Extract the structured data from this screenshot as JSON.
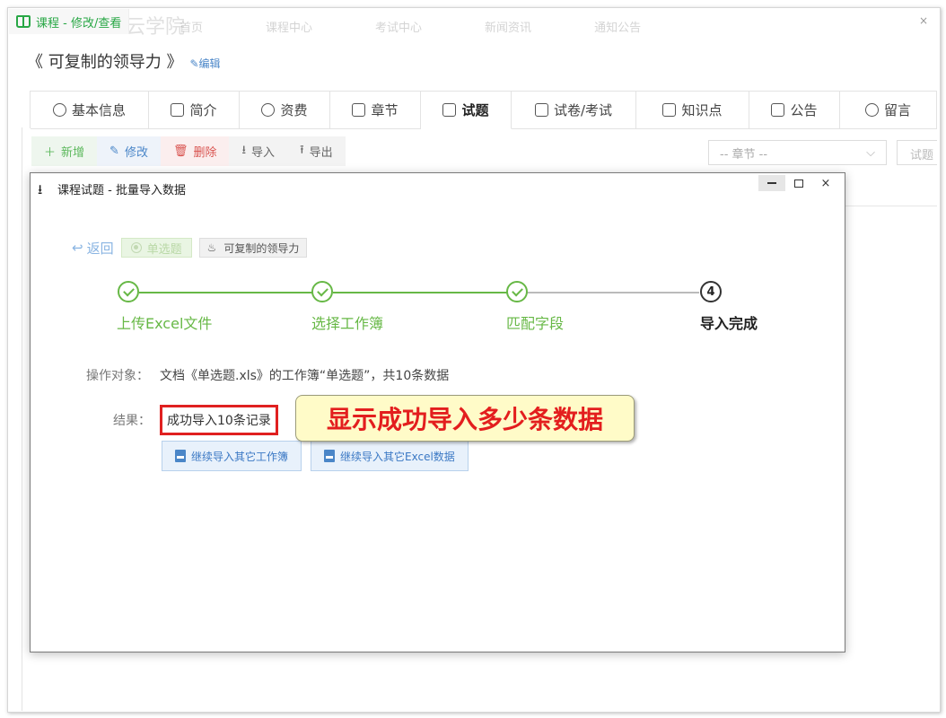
{
  "window": {
    "tab_title": "课程 - 修改/查看",
    "close_symbol": "×",
    "bg_nav": [
      "首页",
      "课程中心",
      "考试中心",
      "新闻资讯",
      "通知公告"
    ]
  },
  "course": {
    "title": "《 可复制的领导力 》",
    "edit_label": "编辑"
  },
  "tabs": [
    {
      "label": "基本信息",
      "icon": "gear-icon"
    },
    {
      "label": "简介",
      "icon": "doc-edit-icon"
    },
    {
      "label": "资费",
      "icon": "money-bag-icon"
    },
    {
      "label": "章节",
      "icon": "chapter-icon"
    },
    {
      "label": "试题",
      "icon": "list-icon",
      "active": true
    },
    {
      "label": "试卷/考试",
      "icon": "paper-icon"
    },
    {
      "label": "知识点",
      "icon": "note-icon"
    },
    {
      "label": "公告",
      "icon": "notice-icon"
    },
    {
      "label": "留言",
      "icon": "message-icon"
    }
  ],
  "toolbar": {
    "add": "新增",
    "modify": "修改",
    "delete": "删除",
    "import": "导入",
    "export": "导出"
  },
  "filters": {
    "chapter_placeholder": "-- 章节 --",
    "search_placeholder": "试题"
  },
  "dialog": {
    "title": "课程试题 - 批量导入数据",
    "back": "返回",
    "question_type": "单选题",
    "course_tag": "可复制的领导力",
    "steps": [
      {
        "label": "上传Excel文件",
        "state": "done"
      },
      {
        "label": "选择工作簿",
        "state": "done"
      },
      {
        "label": "匹配字段",
        "state": "done"
      },
      {
        "label": "导入完成",
        "state": "current",
        "number": "4"
      }
    ],
    "op_label": "操作对象：",
    "op_value": "文档《单选题.xls》的工作簿“单选题”，共10条数据",
    "result_label": "结果：",
    "result_value": "成功导入10条记录",
    "btn_continue_sheet": "继续导入其它工作簿",
    "btn_continue_excel": "继续导入其它Excel数据"
  },
  "annotation": {
    "callout": "显示成功导入多少条数据"
  },
  "colors": {
    "green": "#67b846",
    "blue": "#4a86c8",
    "red": "#e02020",
    "callout_bg": "#fffbc8"
  }
}
